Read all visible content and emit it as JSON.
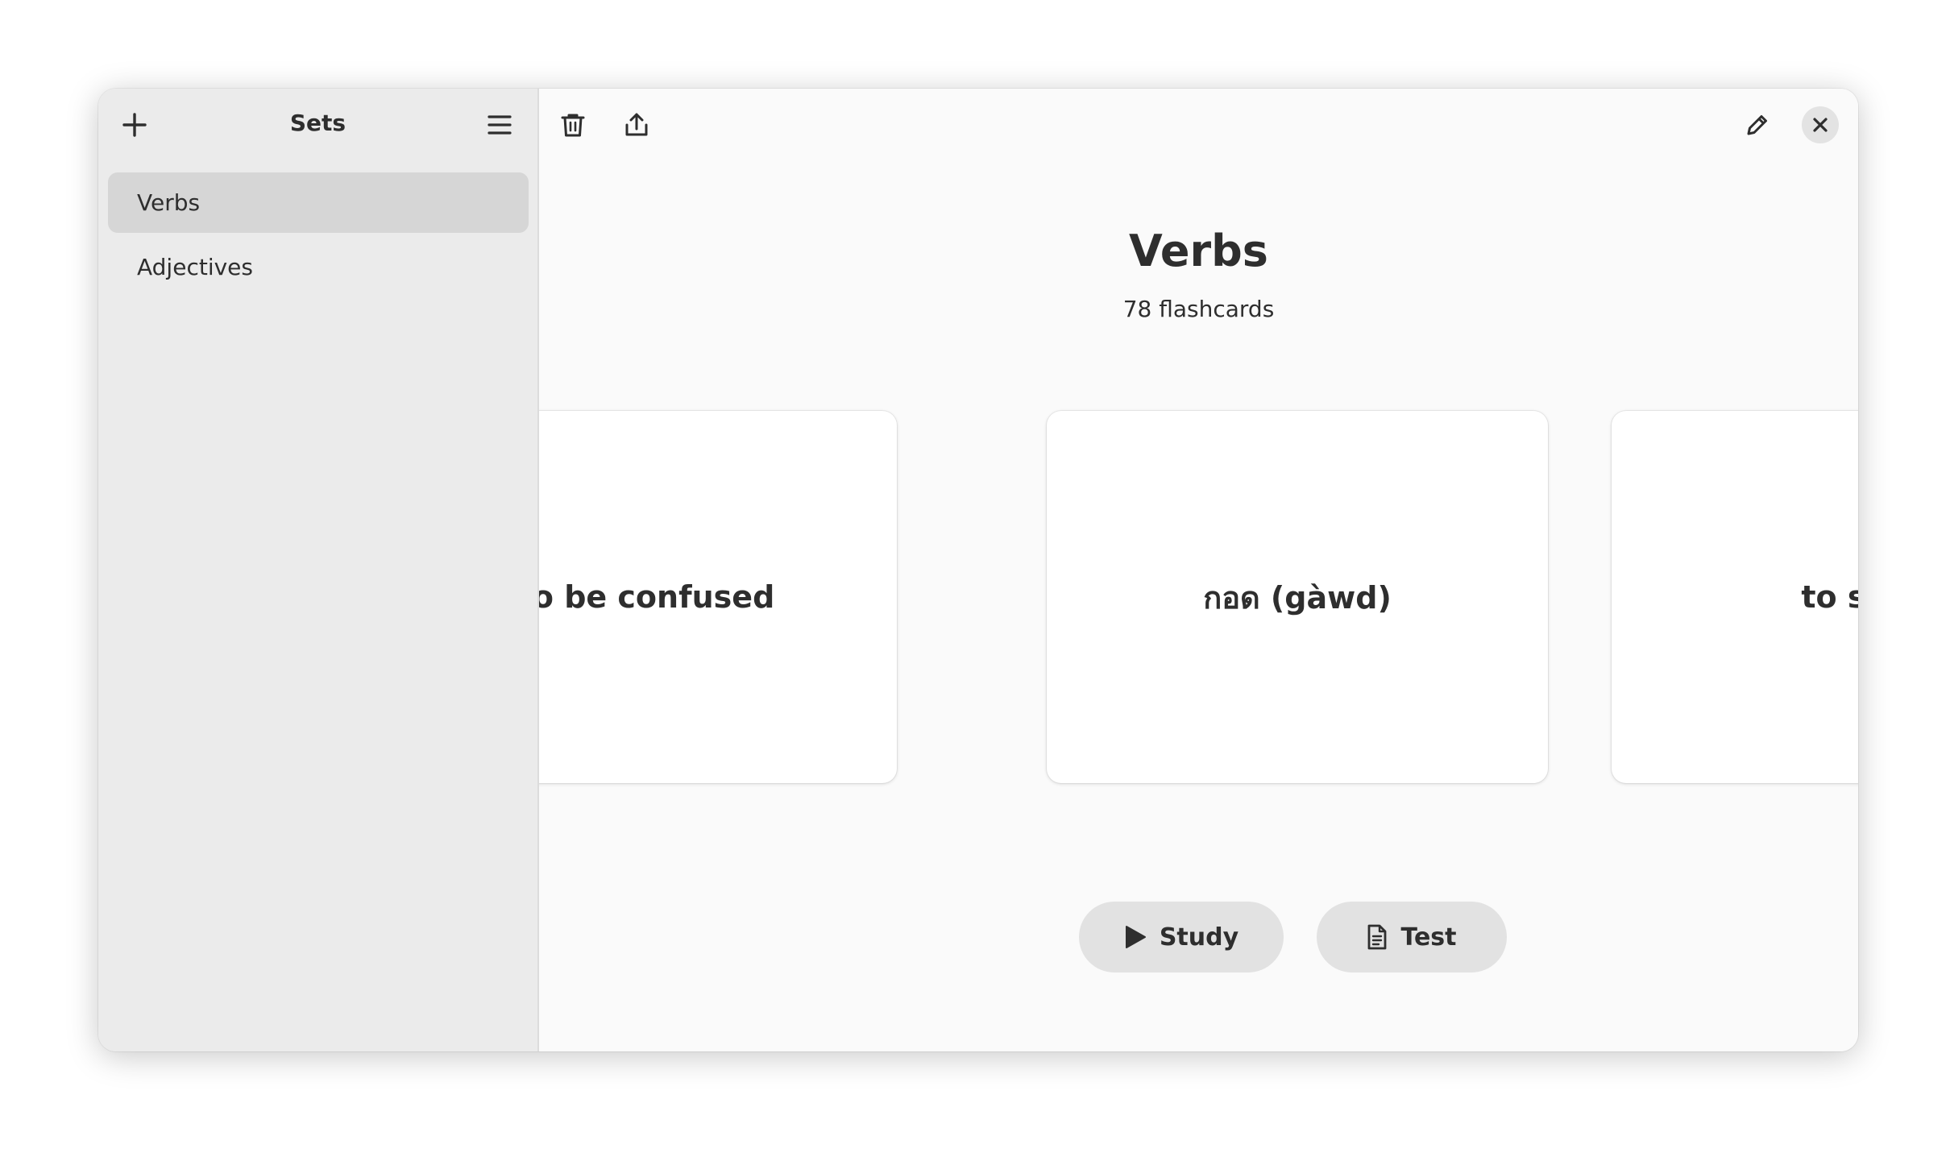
{
  "sidebar": {
    "title": "Sets",
    "add_icon": "plus-icon",
    "menu_icon": "hamburger-menu-icon",
    "items": [
      {
        "label": "Verbs",
        "selected": true
      },
      {
        "label": "Adjectives",
        "selected": false
      }
    ]
  },
  "toolbar": {
    "delete_icon": "trash-icon",
    "export_icon": "share-upload-icon",
    "edit_icon": "pencil-icon",
    "close_icon": "close-icon"
  },
  "main": {
    "title": "Verbs",
    "subtitle": "78 flashcards",
    "cards": [
      {
        "text": "to be confused"
      },
      {
        "text": "กอด (gàwd)"
      },
      {
        "text": "to step"
      }
    ],
    "study_label": "Study",
    "test_label": "Test",
    "study_icon": "play-icon",
    "test_icon": "document-icon"
  },
  "colors": {
    "sidebar_bg": "#ebebeb",
    "selected_item_bg": "#d6d6d6",
    "main_bg": "#fafafa",
    "card_bg": "#ffffff",
    "button_bg": "#e2e2e2",
    "text": "#2e2e2e"
  }
}
